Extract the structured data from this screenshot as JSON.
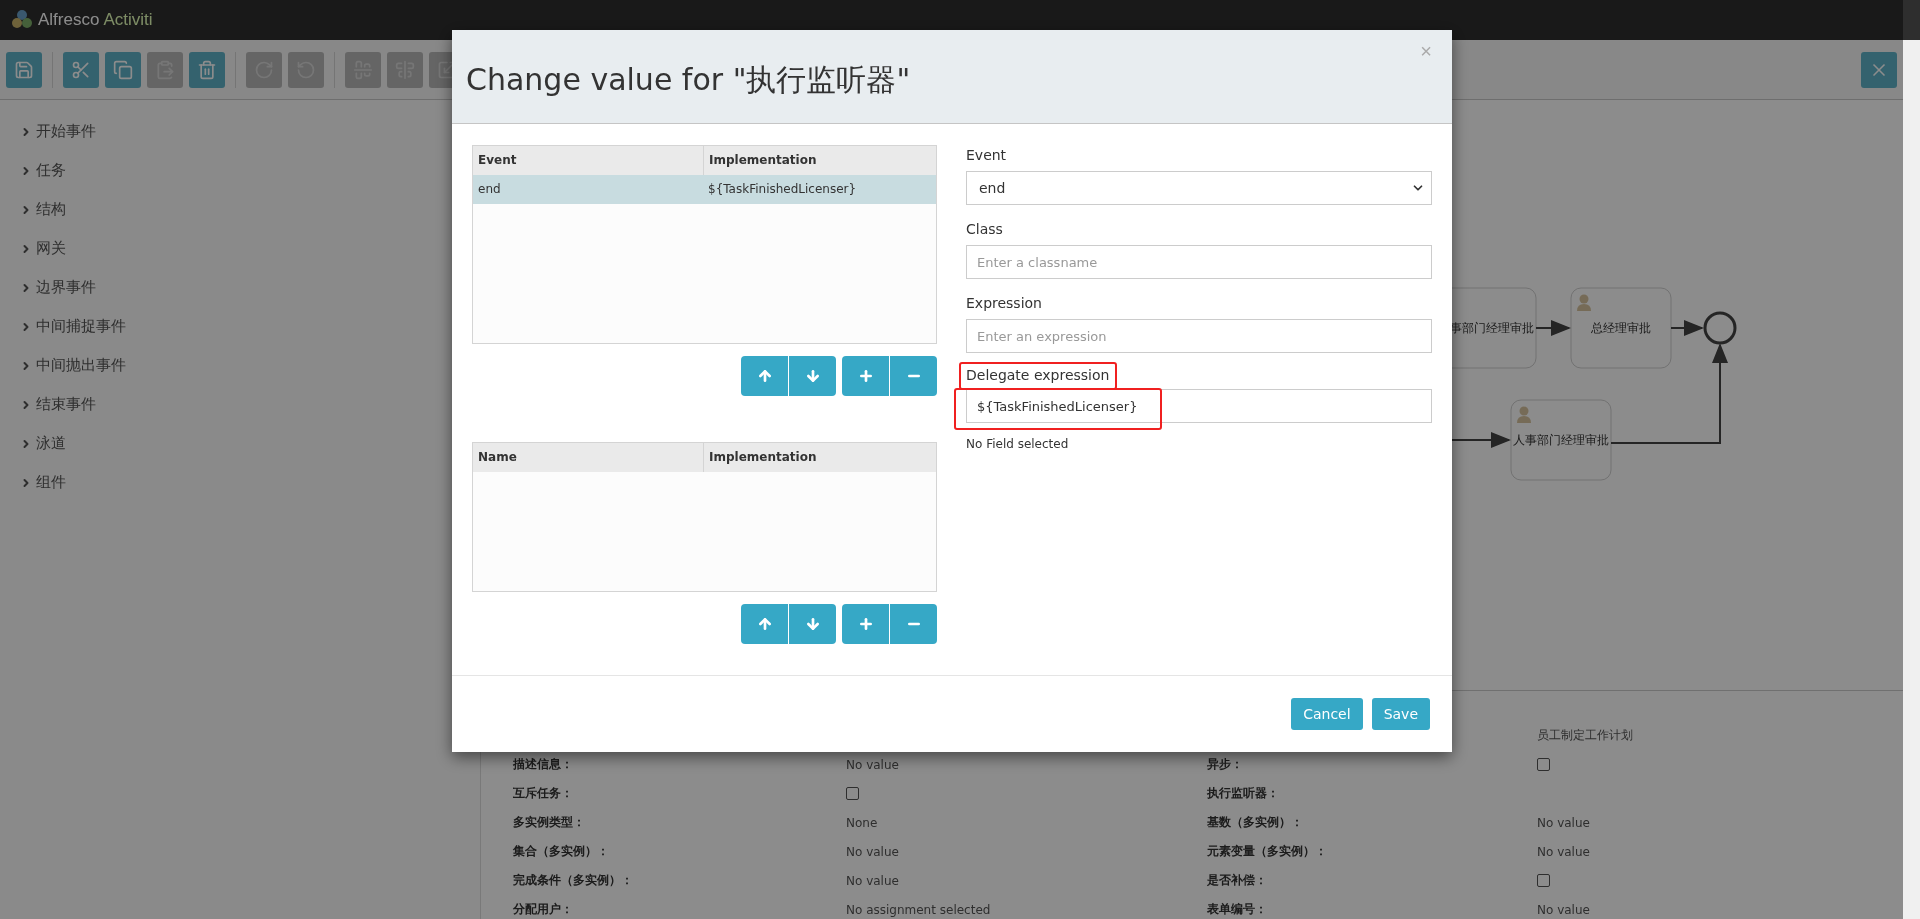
{
  "app": {
    "logo_name": "Alfresco",
    "logo_product": "Activiti"
  },
  "toolbar": {
    "groups": [
      [
        {
          "kind": "save",
          "disabled": false
        }
      ],
      [
        {
          "kind": "cut",
          "disabled": false
        },
        {
          "kind": "copy",
          "disabled": false
        },
        {
          "kind": "paste",
          "disabled": true
        },
        {
          "kind": "delete",
          "disabled": false
        }
      ],
      [
        {
          "kind": "redo",
          "disabled": true
        },
        {
          "kind": "undo",
          "disabled": true
        }
      ],
      [
        {
          "kind": "align-horizontal",
          "disabled": true
        },
        {
          "kind": "align-vertical",
          "disabled": true
        },
        {
          "kind": "resize",
          "disabled": true
        }
      ]
    ],
    "right_button": {
      "kind": "close",
      "disabled": false
    }
  },
  "sidebar": {
    "items": [
      {
        "label": "开始事件",
        "expanded": false
      },
      {
        "label": "任务",
        "expanded": false
      },
      {
        "label": "结构",
        "expanded": false
      },
      {
        "label": "网关",
        "expanded": false
      },
      {
        "label": "边界事件",
        "expanded": false
      },
      {
        "label": "中间捕捉事件",
        "expanded": false
      },
      {
        "label": "中间抛出事件",
        "expanded": false
      },
      {
        "label": "结束事件",
        "expanded": false
      },
      {
        "label": "泳道",
        "expanded": false
      },
      {
        "label": "组件",
        "expanded": false
      }
    ]
  },
  "diagram": {
    "nodes": [
      {
        "label": "事部门经理审批",
        "kind": "partial"
      },
      {
        "label": "总经理审批",
        "kind": "user_task"
      },
      {
        "label": "人事部门经理审批",
        "kind": "user_task"
      }
    ]
  },
  "properties": {
    "rows": [
      [
        {},
        {
          "kind": "none"
        },
        {},
        {
          "kind": "text",
          "value": "员工制定工作计划"
        }
      ],
      [
        {
          "label": "描述信息："
        },
        {
          "kind": "text",
          "value": "No value"
        },
        {
          "label": "异步："
        },
        {
          "kind": "checkbox",
          "checked": false
        }
      ],
      [
        {
          "label": "互斥任务："
        },
        {
          "kind": "checkbox",
          "checked": false
        },
        {
          "label": "执行监听器："
        },
        {
          "kind": "none"
        }
      ],
      [
        {
          "label": "多实例类型："
        },
        {
          "kind": "text",
          "value": "None"
        },
        {
          "label": "基数（多实例）："
        },
        {
          "kind": "text",
          "value": "No value"
        }
      ],
      [
        {
          "label": "集合（多实例）："
        },
        {
          "kind": "text",
          "value": "No value"
        },
        {
          "label": "元素变量（多实例）："
        },
        {
          "kind": "text",
          "value": "No value"
        }
      ],
      [
        {
          "label": "完成条件（多实例）："
        },
        {
          "kind": "text",
          "value": "No value"
        },
        {
          "label": "是否补偿："
        },
        {
          "kind": "checkbox",
          "checked": false
        }
      ],
      [
        {
          "label": "分配用户："
        },
        {
          "kind": "text",
          "value": "No assignment selected"
        },
        {
          "label": "表单编号："
        },
        {
          "kind": "text",
          "value": "No value"
        }
      ]
    ]
  },
  "dialog": {
    "title": "Change value for \"执行监听器\"",
    "close": "×",
    "listeners_table": {
      "columns": [
        "Event",
        "Implementation"
      ],
      "rows": [
        {
          "cells": [
            "end",
            "${TaskFinishedLicenser}"
          ],
          "selected": true
        }
      ]
    },
    "fields_table": {
      "columns": [
        "Name",
        "Implementation"
      ]
    },
    "list_buttons": [
      [
        {
          "kind": "up"
        },
        {
          "kind": "down"
        }
      ],
      [
        {
          "kind": "add"
        },
        {
          "kind": "remove"
        }
      ]
    ],
    "form": [
      {
        "label": "Event",
        "kind": "select",
        "value": "end",
        "highlighted": false
      },
      {
        "label": "Class",
        "kind": "input",
        "placeholder": "Enter a classname",
        "highlighted": false
      },
      {
        "label": "Expression",
        "kind": "input",
        "placeholder": "Enter an expression",
        "highlighted": false
      },
      {
        "label": "Delegate expression",
        "kind": "input",
        "value": "${TaskFinishedLicenser}",
        "highlighted": true
      }
    ],
    "field_note": "No Field selected",
    "buttons": [
      {
        "label": "Cancel"
      },
      {
        "label": "Save"
      }
    ]
  }
}
